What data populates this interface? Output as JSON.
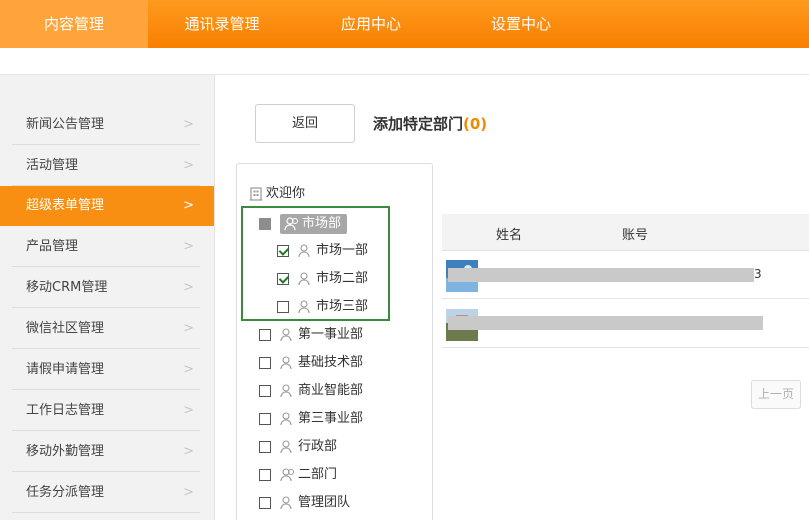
{
  "topnav": {
    "tabs": [
      {
        "label": "内容管理",
        "active": true
      },
      {
        "label": "通讯录管理",
        "active": false
      },
      {
        "label": "应用中心",
        "active": false
      },
      {
        "label": "设置中心",
        "active": false
      }
    ]
  },
  "sidebar": {
    "items": [
      {
        "label": "新闻公告管理",
        "active": false
      },
      {
        "label": "活动管理",
        "active": false
      },
      {
        "label": "超级表单管理",
        "active": true
      },
      {
        "label": "产品管理",
        "active": false
      },
      {
        "label": "移动CRM管理",
        "active": false
      },
      {
        "label": "微信社区管理",
        "active": false
      },
      {
        "label": "请假申请管理",
        "active": false
      },
      {
        "label": "工作日志管理",
        "active": false
      },
      {
        "label": "移动外勤管理",
        "active": false
      },
      {
        "label": "任务分派管理",
        "active": false
      }
    ],
    "chevron": ">"
  },
  "header": {
    "back_label": "返回",
    "title": "添加特定部门",
    "count": "(0)"
  },
  "tree": {
    "root": "欢迎你",
    "nodes": [
      {
        "label": "市场部",
        "state": "partial",
        "level": 0,
        "highlight": true
      },
      {
        "label": "市场一部",
        "state": "checked",
        "level": 1
      },
      {
        "label": "市场二部",
        "state": "checked",
        "level": 1
      },
      {
        "label": "市场三部",
        "state": "unchecked",
        "level": 1
      },
      {
        "label": "第一事业部",
        "state": "unchecked",
        "level": 0
      },
      {
        "label": "基础技术部",
        "state": "unchecked",
        "level": 0
      },
      {
        "label": "商业智能部",
        "state": "unchecked",
        "level": 0
      },
      {
        "label": "第三事业部",
        "state": "unchecked",
        "level": 0
      },
      {
        "label": "行政部",
        "state": "unchecked",
        "level": 0
      },
      {
        "label": "二部门",
        "state": "unchecked",
        "level": 0
      },
      {
        "label": "管理团队",
        "state": "unchecked",
        "level": 0
      }
    ]
  },
  "table": {
    "columns": [
      "姓名",
      "账号"
    ],
    "rows": [
      {
        "account_tail": "3"
      },
      {
        "account_tail": ""
      }
    ]
  },
  "pager": {
    "prev_label": "上一页"
  },
  "colors": {
    "accent": "#f98f12",
    "frame": "#3c8a3c"
  }
}
